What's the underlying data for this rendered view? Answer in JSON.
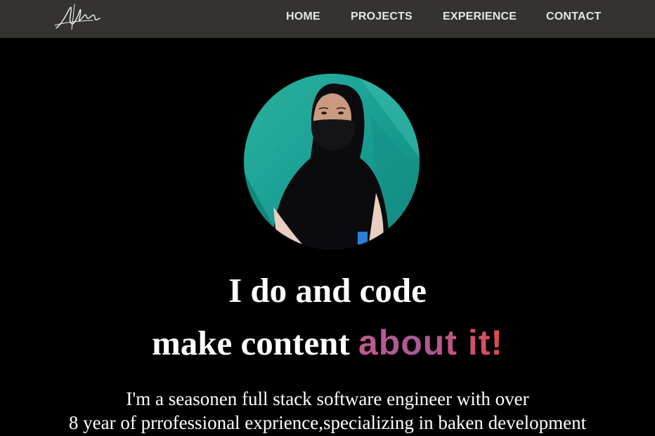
{
  "nav": {
    "logo_alt": "signature logo",
    "items": [
      {
        "label": "HOME"
      },
      {
        "label": "PROJECTS"
      },
      {
        "label": "EXPERIENCE"
      },
      {
        "label": "CONTACT"
      }
    ]
  },
  "hero": {
    "headline_line1": "I do and code",
    "headline_line2_prefix": "make content ",
    "headline_line2_highlight": "about it!",
    "bio_line1": "I'm a seasonen full stack software engineer with over",
    "bio_line2": "8 year of prrofessional exprience,specializing in baken development"
  },
  "colors": {
    "background": "#000000",
    "navbar": "#343330",
    "nav_text": "#e6e6e6",
    "avatar_bg": "#1fa89a",
    "highlight_gradient": [
      "#c05a8a",
      "#a85a9a",
      "#e04a4a"
    ]
  },
  "icons": {
    "logo": "signature-logo-icon",
    "avatar": "profile-photo"
  }
}
